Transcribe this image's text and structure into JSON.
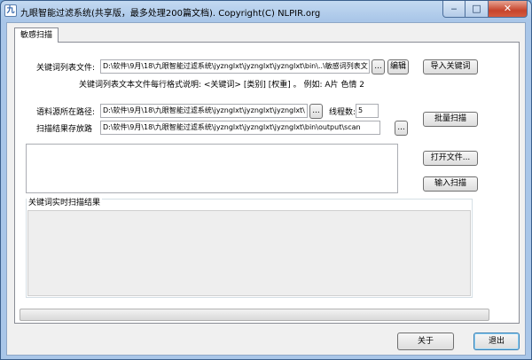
{
  "window": {
    "title": "九眼智能过滤系统(共享版，最多处理200篇文档). Copyright(C) NLPIR.org",
    "icon_name": "app-logo-icon"
  },
  "tabs": [
    {
      "label": "敏感扫描",
      "active": true
    }
  ],
  "keyword_list": {
    "label": "关键词列表文件:",
    "value": "D:\\软件\\9月\\18\\九眼智能过滤系统\\jyznglxt\\jyznglxt\\jyznglxt\\bin\\..\\敏感词列表文",
    "browse_label": "...",
    "edit_label": "编辑",
    "import_label": "导入关键词",
    "format_hint": "关键词列表文本文件每行格式说明: <关键词> [类别] [权重] 。 例如: A片 色情 2"
  },
  "corpus": {
    "label": "语料源所在路径:",
    "value": "D:\\软件\\9月\\18\\九眼智能过滤系统\\jyznglxt\\jyznglxt\\jyznglxt\\",
    "browse_label": "...",
    "threads_label": "线程数:",
    "threads_value": "5",
    "batch_scan_label": "批量扫描"
  },
  "output": {
    "label": "扫描结果存放路",
    "value": "D:\\软件\\9月\\18\\九眼智能过滤系统\\jyznglxt\\jyznglxt\\jyznglxt\\bin\\output\\scan",
    "browse_label": "..."
  },
  "side_buttons": {
    "open_file": "打开文件...",
    "input_scan": "输入扫描"
  },
  "realtime": {
    "title": "关键词实时扫描结果"
  },
  "progress": {
    "value": 0
  },
  "footer": {
    "about_label": "关于",
    "exit_label": "退出"
  }
}
